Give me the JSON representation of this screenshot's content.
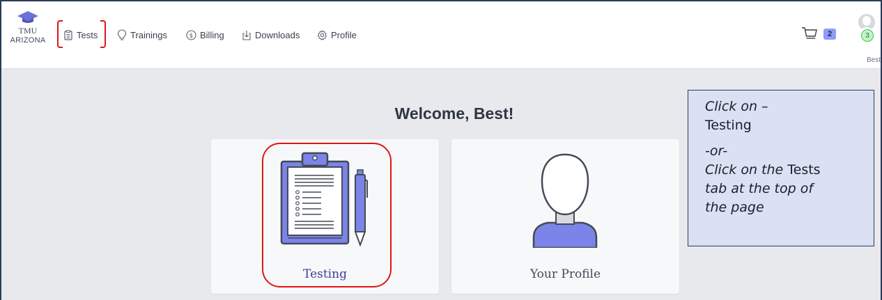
{
  "logo": {
    "line1": "TMU",
    "line2": "ARIZONA"
  },
  "nav": {
    "items": [
      {
        "label": "Tests",
        "icon": "clipboard-icon"
      },
      {
        "label": "Trainings",
        "icon": "lightbulb-icon"
      },
      {
        "label": "Billing",
        "icon": "dollar-circle-icon"
      },
      {
        "label": "Downloads",
        "icon": "download-icon"
      },
      {
        "label": "Profile",
        "icon": "gear-icon"
      }
    ]
  },
  "cart": {
    "count": "2",
    "icon": "cart-icon"
  },
  "user": {
    "badge": "3",
    "name": "Best",
    "icon": "avatar-icon"
  },
  "main": {
    "welcome": "Welcome, Best!",
    "cards": [
      {
        "label": "Testing",
        "icon": "clipboard-illustration"
      },
      {
        "label": "Your Profile",
        "icon": "person-illustration"
      }
    ]
  },
  "callout": {
    "line1": "Click on –",
    "line2": "Testing",
    "line3": "-or-",
    "line4_prefix": "Click on the ",
    "line4_strong": "Tests",
    "line5": "tab at the top of",
    "line6": "the page"
  },
  "colors": {
    "accent": "#7b84e8",
    "highlight": "#e01515",
    "callout_bg": "#d9e1f2"
  }
}
